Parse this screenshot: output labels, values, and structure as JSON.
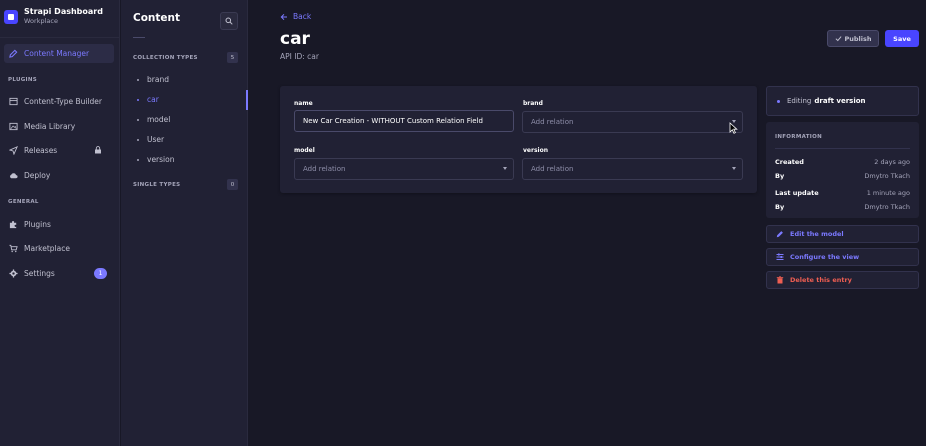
{
  "brand": {
    "title": "Strapi Dashboard",
    "subtitle": "Workplace"
  },
  "mainnav": {
    "content_manager": "Content Manager",
    "plugins_section": "PLUGINS",
    "content_type_builder": "Content-Type Builder",
    "media_library": "Media Library",
    "releases": "Releases",
    "deploy": "Deploy",
    "general_section": "GENERAL",
    "plugins": "Plugins",
    "marketplace": "Marketplace",
    "settings": "Settings",
    "settings_badge": "1"
  },
  "subnav": {
    "title": "Content",
    "collection_types_label": "COLLECTION TYPES",
    "collection_types_count": "5",
    "items": [
      "brand",
      "car",
      "model",
      "User",
      "version"
    ],
    "active_item": "car",
    "single_types_label": "SINGLE TYPES",
    "single_types_count": "0"
  },
  "header": {
    "back": "Back",
    "title": "car",
    "api_id": "API ID: car",
    "publish": "Publish",
    "save": "Save"
  },
  "form": {
    "name_label": "name",
    "name_value": "New Car Creation - WITHOUT Custom Relation Field",
    "brand_label": "brand",
    "brand_placeholder": "Add relation",
    "model_label": "model",
    "model_placeholder": "Add relation",
    "version_label": "version",
    "version_placeholder": "Add relation"
  },
  "side": {
    "editing_prefix": "Editing",
    "editing_version": "draft version",
    "info_title": "INFORMATION",
    "created_label": "Created",
    "created_value": "2 days ago",
    "created_by_label": "By",
    "created_by_value": "Dmytro Tkach",
    "updated_label": "Last update",
    "updated_value": "1 minute ago",
    "updated_by_label": "By",
    "updated_by_value": "Dmytro Tkach",
    "edit_model": "Edit the model",
    "configure_view": "Configure the view",
    "delete_entry": "Delete this entry"
  },
  "colors": {
    "accent": "#7b79ff",
    "primary": "#4945ff",
    "danger": "#ee5e52",
    "background": "#181826",
    "panel": "#212134"
  }
}
